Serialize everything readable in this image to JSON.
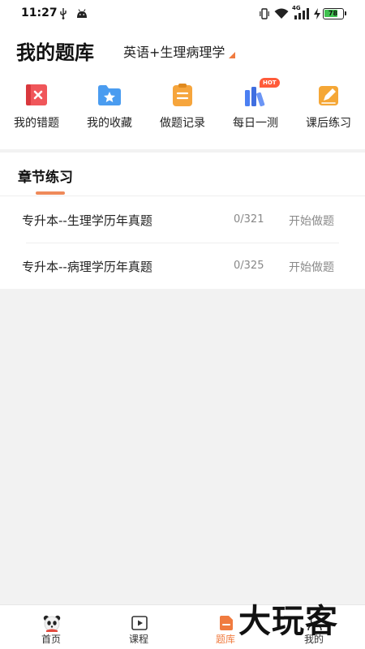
{
  "status_bar": {
    "time": "11:27",
    "network": "4G",
    "battery": 78,
    "battery_label": "78"
  },
  "header": {
    "title": "我的题库",
    "subject": "英语+生理病理学"
  },
  "quick_actions": [
    {
      "label": "我的错题",
      "icon": "wrong-book-icon",
      "color": "#f0565a"
    },
    {
      "label": "我的收藏",
      "icon": "star-folder-icon",
      "color": "#4a9cf0"
    },
    {
      "label": "做题记录",
      "icon": "clipboard-icon",
      "color": "#f6a53c"
    },
    {
      "label": "每日一测",
      "icon": "books-icon",
      "color": "#4b7ff2",
      "badge": "HOT"
    },
    {
      "label": "课后练习",
      "icon": "pencil-note-icon",
      "color": "#f5a736"
    }
  ],
  "section": {
    "title": "章节练习",
    "rows": [
      {
        "title": "专升本--生理学历年真题",
        "progress": "0/321",
        "action": "开始做题"
      },
      {
        "title": "专升本--病理学历年真题",
        "progress": "0/325",
        "action": "开始做题"
      }
    ]
  },
  "tabbar": {
    "tabs": [
      {
        "label": "首页",
        "icon": "panda-icon"
      },
      {
        "label": "课程",
        "icon": "play-icon"
      },
      {
        "label": "题库",
        "icon": "question-bank-icon",
        "active": true
      },
      {
        "label": "我的",
        "icon": "profile-icon"
      }
    ]
  },
  "watermark": "大玩客",
  "colors": {
    "accent": "#f07b3f",
    "hot_badge": "#ff5b3a"
  }
}
